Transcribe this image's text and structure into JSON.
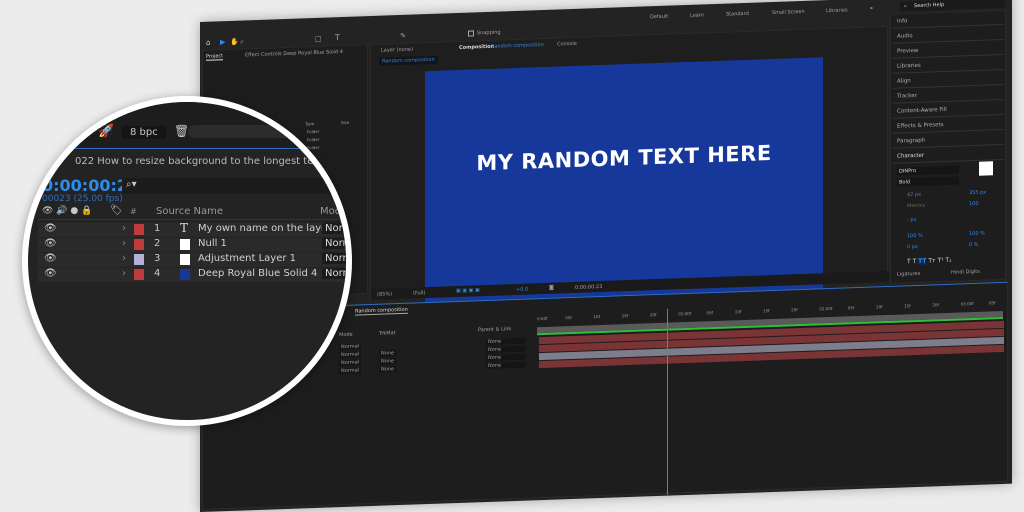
{
  "workspaces": [
    "Default",
    "Learn",
    "Standard",
    "Small Screen",
    "Libraries"
  ],
  "search_help": "Search Help",
  "toolbar": {
    "snapping": "Snapping"
  },
  "project": {
    "tab": "Project",
    "effect_controls": "Effect Controls Deep Royal Blue Solid 4",
    "bpc": "8 bpc",
    "type_header": "Type",
    "size_header": "Size",
    "items": [
      "Folder",
      "Folder",
      "Folder"
    ]
  },
  "viewer": {
    "layer_tab": "Layer (none)",
    "comp_tab_prefix": "Composition",
    "comp_tab_name": "Random composition",
    "console_tab": "Console",
    "breadcrumb": "Random composition",
    "comp_text": "MY RANDOM TEXT HERE",
    "comp_color": "#15389a",
    "zoom": "(85%)",
    "resolution": "(Full)",
    "exposure": "+0.0",
    "timecode": "0:00:00:23"
  },
  "right_panels": [
    "Info",
    "Audio",
    "Preview",
    "Libraries",
    "Align",
    "Tracker",
    "Content-Aware Fill",
    "Effects & Presets",
    "Paragraph"
  ],
  "character": {
    "title": "Character",
    "font": "DINPro",
    "style": "Bold",
    "size": "47 px",
    "leading": "355 px",
    "kerning": "Metrics",
    "tracking": "100",
    "stroke": "- px",
    "vscale": "100 %",
    "hscale": "100 %",
    "baseline": "0 px",
    "tsume": "0 %",
    "ligatures": "Ligatures",
    "hindi_digits": "Hindi Digits"
  },
  "timeline": {
    "tab": "Random composition",
    "path": "022 How to resize background to the longest text",
    "current_time": "0:00:00:23",
    "frame_info": "00023 (25.00 fps)",
    "columns": {
      "number": "#",
      "source_name": "Source Name",
      "mode": "Mode",
      "trkmat": "TrkMat",
      "parent": "Parent & Link",
      "t": "T"
    },
    "layers": [
      {
        "num": "1",
        "name": "My own name on the layer",
        "label_color": "#c0393b",
        "type": "text",
        "mode": "Normal",
        "trkmat": "",
        "parent": "None",
        "bar_color": "#7a3436"
      },
      {
        "num": "2",
        "name": "Null 1",
        "label_color": "#c0393b",
        "type": "null",
        "mode": "Normal",
        "trkmat": "None",
        "parent": "None",
        "bar_color": "#7a3436"
      },
      {
        "num": "3",
        "name": "Adjustment Layer 1",
        "label_color": "#b3b1d6",
        "type": "adjustment",
        "mode": "Normal",
        "trkmat": "None",
        "parent": "None",
        "bar_color": "#7d7d8c"
      },
      {
        "num": "4",
        "name": "Deep Royal Blue Solid 4",
        "label_color": "#c0393b",
        "type": "solid",
        "swatch": "#15389a",
        "mode": "Normal",
        "trkmat": "None",
        "parent": "None",
        "bar_color": "#7a3436"
      }
    ],
    "ruler": [
      "0:00f",
      "05f",
      "10f",
      "15f",
      "20f",
      "01:00f",
      "05f",
      "10f",
      "15f",
      "20f",
      "02:00f",
      "05f",
      "10f",
      "15f",
      "20f",
      "03:00f",
      "05f"
    ],
    "playhead_frame": 23
  }
}
